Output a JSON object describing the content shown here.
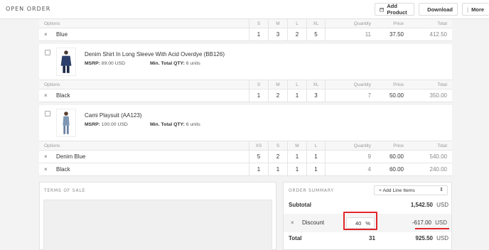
{
  "header": {
    "title": "OPEN ORDER",
    "add_product": "Add Product",
    "download": "Download",
    "more": "More"
  },
  "table1": {
    "headers": [
      "Options",
      "S",
      "M",
      "L",
      "XL",
      "Quantity",
      "Price",
      "Total"
    ],
    "rows": [
      {
        "remove": "×",
        "option": "Blue",
        "sizes": [
          "1",
          "3",
          "2",
          "5"
        ],
        "quantity": "11",
        "price": "37.50",
        "total": "412.50"
      }
    ]
  },
  "product2": {
    "name": "Denim Shirt In Long Sleeve With Acid Overdye (BB126)",
    "msrp_label": "MSRP:",
    "msrp": "89.00 USD",
    "min_label": "Min. Total QTY:",
    "min": "6 units"
  },
  "table2": {
    "headers": [
      "Options",
      "S",
      "M",
      "L",
      "XL",
      "Quantity",
      "Price",
      "Total"
    ],
    "rows": [
      {
        "remove": "×",
        "option": "Black",
        "sizes": [
          "1",
          "2",
          "1",
          "3"
        ],
        "quantity": "7",
        "price": "50.00",
        "total": "350.00"
      }
    ]
  },
  "product3": {
    "name": "Cami Playsuit (AA123)",
    "msrp_label": "MSRP:",
    "msrp": "100.00 USD",
    "min_label": "Min. Total QTY:",
    "min": "6 units"
  },
  "table3": {
    "headers": [
      "Options",
      "XS",
      "S",
      "M",
      "L",
      "Quantity",
      "Price",
      "Total"
    ],
    "rows": [
      {
        "remove": "×",
        "option": "Denim Blue",
        "sizes": [
          "5",
          "2",
          "1",
          "1"
        ],
        "quantity": "9",
        "price": "60.00",
        "total": "540.00"
      },
      {
        "remove": "×",
        "option": "Black",
        "sizes": [
          "1",
          "1",
          "1",
          "1"
        ],
        "quantity": "4",
        "price": "60.00",
        "total": "240.00"
      }
    ]
  },
  "terms": {
    "title": "TERMS OF SALE"
  },
  "summary": {
    "title": "ORDER SUMMARY",
    "add_line_items": "+ Add Line Items",
    "subtotal_label": "Subtotal",
    "subtotal_value": "1,542.50",
    "subtotal_currency": "USD",
    "discount_remove": "×",
    "discount_label": "Discount",
    "discount_percent": "40",
    "percent_sign": "%",
    "discount_value": "-617.00",
    "discount_currency": "USD",
    "total_label": "Total",
    "total_qty": "31",
    "total_value": "925.50",
    "total_currency": "USD"
  },
  "colors": {
    "highlight": "#e0262b"
  }
}
